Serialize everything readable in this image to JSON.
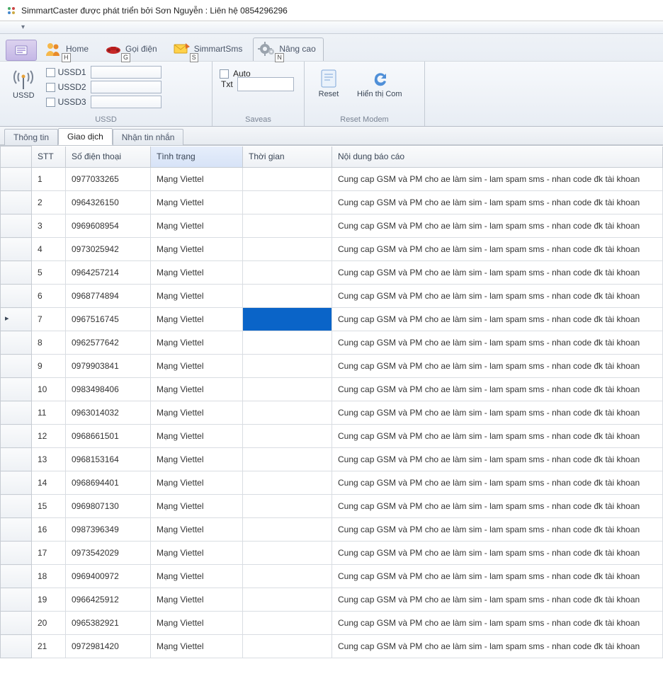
{
  "window": {
    "title": "SimmartCaster được phát triển bởi Sơn Nguyễn : Liên hệ 0854296296"
  },
  "ribbon": {
    "tabs": {
      "home": {
        "label": "Home",
        "keytip": "H"
      },
      "call": {
        "label": "Gọi điện",
        "keytip": "G"
      },
      "sms": {
        "label": "SimmartSms",
        "keytip": "S"
      },
      "advanced": {
        "label": "Nâng cao",
        "keytip": "N"
      }
    },
    "groups": {
      "ussd": {
        "title": "USSD",
        "side_label": "USSD",
        "ussd1": "USSD1",
        "ussd2": "USSD2",
        "ussd3": "USSD3",
        "ussd1_value": "",
        "ussd2_value": "",
        "ussd3_value": ""
      },
      "saveas": {
        "title": "Saveas",
        "auto_label": "Auto",
        "txt_label": "Txt",
        "txt_value": ""
      },
      "reset_modem": {
        "title": "Reset Modem",
        "reset_label": "Reset",
        "show_com_label": "Hiển thị Com"
      }
    }
  },
  "doc_tabs": {
    "info": "Thông tin",
    "trans": "Giao dịch",
    "inbox": "Nhận tin nhắn"
  },
  "grid": {
    "headers": {
      "stt": "STT",
      "phone": "Số điện thoại",
      "status": "Tình trạng",
      "time": "Thời gian",
      "report": "Nội dung báo cáo"
    },
    "selected_index": 6,
    "rows": [
      {
        "stt": "1",
        "phone": "0977033265",
        "status": "Mạng Viettel",
        "time": "",
        "report": "Cung cap GSM và PM cho ae làm sim - lam spam sms - nhan code đk tài khoan"
      },
      {
        "stt": "2",
        "phone": "0964326150",
        "status": "Mạng Viettel",
        "time": "",
        "report": "Cung cap GSM và PM cho ae làm sim - lam spam sms - nhan code đk tài khoan"
      },
      {
        "stt": "3",
        "phone": "0969608954",
        "status": "Mạng Viettel",
        "time": "",
        "report": "Cung cap GSM và PM cho ae làm sim - lam spam sms - nhan code đk tài khoan"
      },
      {
        "stt": "4",
        "phone": "0973025942",
        "status": "Mạng Viettel",
        "time": "",
        "report": "Cung cap GSM và PM cho ae làm sim - lam spam sms - nhan code đk tài khoan"
      },
      {
        "stt": "5",
        "phone": "0964257214",
        "status": "Mạng Viettel",
        "time": "",
        "report": "Cung cap GSM và PM cho ae làm sim - lam spam sms - nhan code đk tài khoan"
      },
      {
        "stt": "6",
        "phone": "0968774894",
        "status": "Mạng Viettel",
        "time": "",
        "report": "Cung cap GSM và PM cho ae làm sim - lam spam sms - nhan code đk tài khoan"
      },
      {
        "stt": "7",
        "phone": "0967516745",
        "status": "Mạng Viettel",
        "time": "",
        "report": "Cung cap GSM và PM cho ae làm sim - lam spam sms - nhan code đk tài khoan"
      },
      {
        "stt": "8",
        "phone": "0962577642",
        "status": "Mạng Viettel",
        "time": "",
        "report": "Cung cap GSM và PM cho ae làm sim - lam spam sms - nhan code đk tài khoan"
      },
      {
        "stt": "9",
        "phone": "0979903841",
        "status": "Mạng Viettel",
        "time": "",
        "report": "Cung cap GSM và PM cho ae làm sim - lam spam sms - nhan code đk tài khoan"
      },
      {
        "stt": "10",
        "phone": "0983498406",
        "status": "Mạng Viettel",
        "time": "",
        "report": "Cung cap GSM và PM cho ae làm sim - lam spam sms - nhan code đk tài khoan"
      },
      {
        "stt": "11",
        "phone": "0963014032",
        "status": "Mạng Viettel",
        "time": "",
        "report": "Cung cap GSM và PM cho ae làm sim - lam spam sms - nhan code đk tài khoan"
      },
      {
        "stt": "12",
        "phone": "0968661501",
        "status": "Mạng Viettel",
        "time": "",
        "report": "Cung cap GSM và PM cho ae làm sim - lam spam sms - nhan code đk tài khoan"
      },
      {
        "stt": "13",
        "phone": "0968153164",
        "status": "Mạng Viettel",
        "time": "",
        "report": "Cung cap GSM và PM cho ae làm sim - lam spam sms - nhan code đk tài khoan"
      },
      {
        "stt": "14",
        "phone": "0968694401",
        "status": "Mạng Viettel",
        "time": "",
        "report": "Cung cap GSM và PM cho ae làm sim - lam spam sms - nhan code đk tài khoan"
      },
      {
        "stt": "15",
        "phone": "0969807130",
        "status": "Mạng Viettel",
        "time": "",
        "report": "Cung cap GSM và PM cho ae làm sim - lam spam sms - nhan code đk tài khoan"
      },
      {
        "stt": "16",
        "phone": "0987396349",
        "status": "Mạng Viettel",
        "time": "",
        "report": "Cung cap GSM và PM cho ae làm sim - lam spam sms - nhan code đk tài khoan"
      },
      {
        "stt": "17",
        "phone": "0973542029",
        "status": "Mạng Viettel",
        "time": "",
        "report": "Cung cap GSM và PM cho ae làm sim - lam spam sms - nhan code đk tài khoan"
      },
      {
        "stt": "18",
        "phone": "0969400972",
        "status": "Mạng Viettel",
        "time": "",
        "report": "Cung cap GSM và PM cho ae làm sim - lam spam sms - nhan code đk tài khoan"
      },
      {
        "stt": "19",
        "phone": "0966425912",
        "status": "Mạng Viettel",
        "time": "",
        "report": "Cung cap GSM và PM cho ae làm sim - lam spam sms - nhan code đk tài khoan"
      },
      {
        "stt": "20",
        "phone": "0965382921",
        "status": "Mạng Viettel",
        "time": "",
        "report": "Cung cap GSM và PM cho ae làm sim - lam spam sms - nhan code đk tài khoan"
      },
      {
        "stt": "21",
        "phone": "0972981420",
        "status": "Mạng Viettel",
        "time": "",
        "report": "Cung cap GSM và PM cho ae làm sim - lam spam sms - nhan code đk tài khoan"
      }
    ]
  }
}
